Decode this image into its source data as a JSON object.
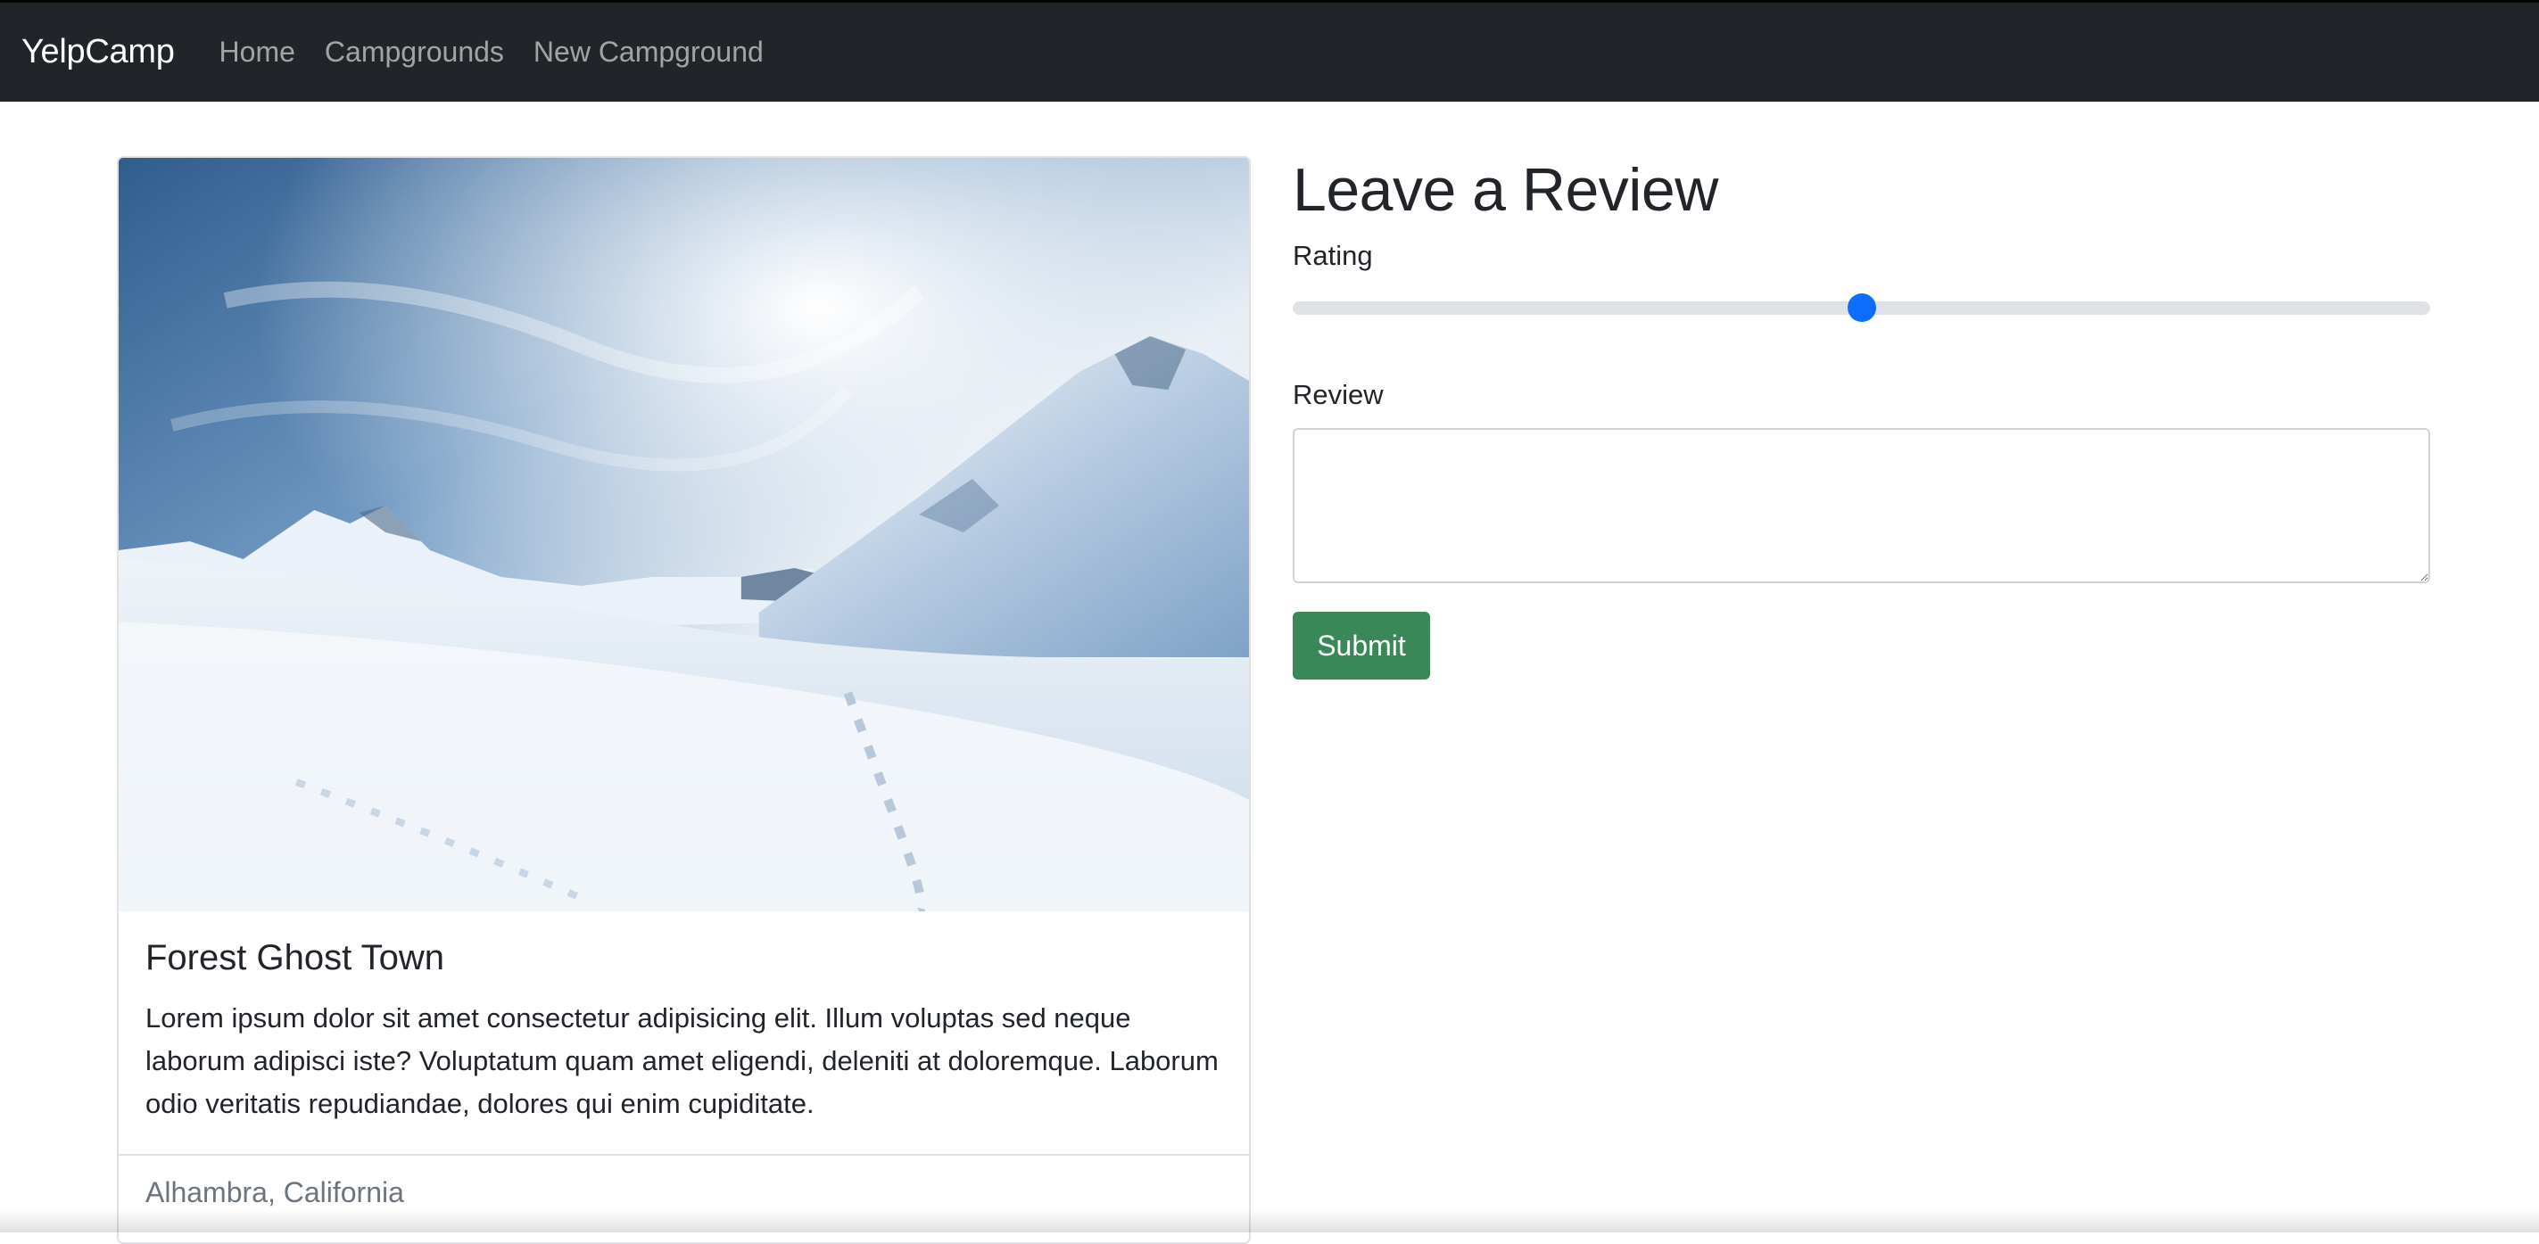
{
  "navbar": {
    "brand": "YelpCamp",
    "links": [
      {
        "label": "Home"
      },
      {
        "label": "Campgrounds"
      },
      {
        "label": "New Campground"
      }
    ]
  },
  "campground": {
    "image": {
      "description_icon": "snowy-mountain-image"
    },
    "title": "Forest Ghost Town",
    "description": "Lorem ipsum dolor sit amet consectetur adipisicing elit. Illum voluptas sed neque laborum adipisci iste? Voluptatum quam amet eligendi, deleniti at doloremque. Laborum odio veritatis repudiandae, dolores qui enim cupiditate.",
    "location": "Alhambra, California"
  },
  "review_form": {
    "heading": "Leave a Review",
    "rating_label": "Rating",
    "rating_value_fraction": 0.5,
    "review_label": "Review",
    "review_value": "",
    "submit_label": "Submit"
  },
  "colors": {
    "navbar_bg": "#212529",
    "accent": "#0d6efd",
    "submit_bg": "#3a8758",
    "muted_text": "#6c757d"
  }
}
